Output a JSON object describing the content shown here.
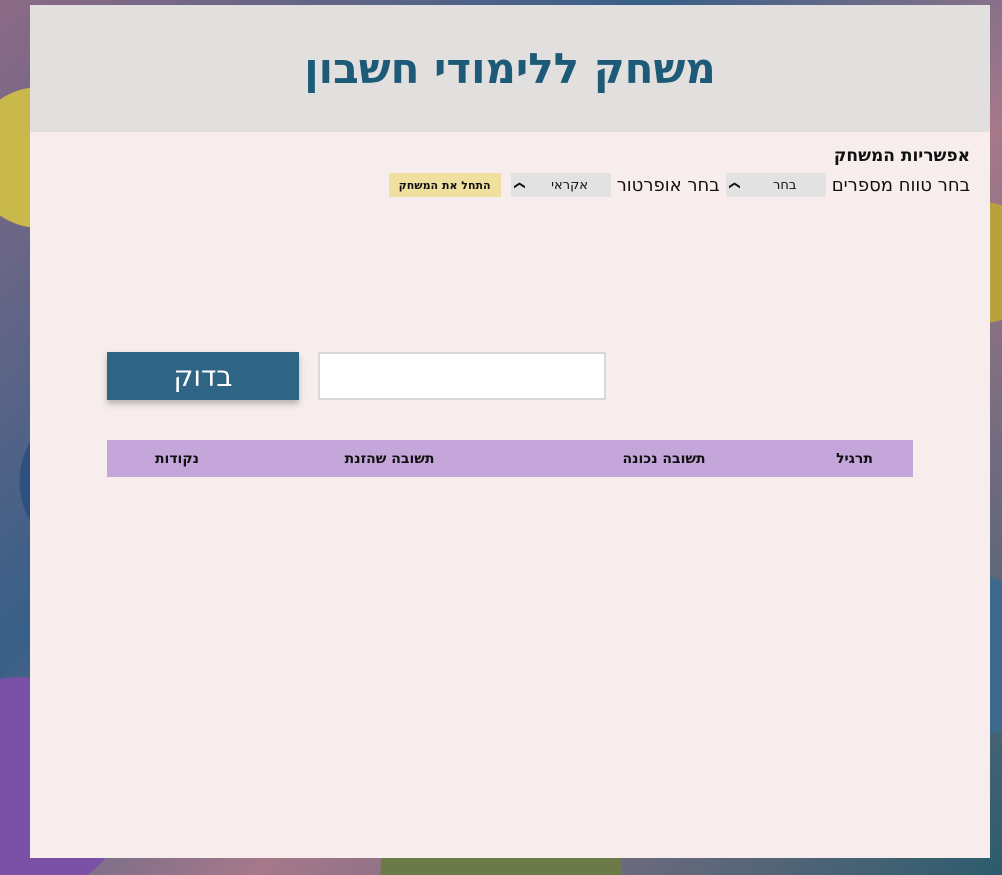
{
  "header": {
    "title": "משחק ללימודי חשבון"
  },
  "options": {
    "title": "אפשריות המשחק",
    "range_label": "בחר טווח מספרים",
    "range_value": "בחר",
    "operator_label": "בחר אופרטור",
    "operator_value": "אקראי",
    "start_label": "התחל את המשחק"
  },
  "answer": {
    "input_value": "",
    "check_label": "בדוק"
  },
  "table": {
    "headers": [
      "תרגיל",
      "תשובה נכונה",
      "תשובה שהזנת",
      "נקודות"
    ]
  },
  "colors": {
    "title": "#1d5a78",
    "check_button": "#2e6584",
    "start_button": "#efe0a0",
    "table_header": "#c4a6db",
    "panel": "#f7eded",
    "header_bg": "#e2dfdf"
  },
  "icons": {
    "select_arrow": "chevron-down-icon"
  }
}
